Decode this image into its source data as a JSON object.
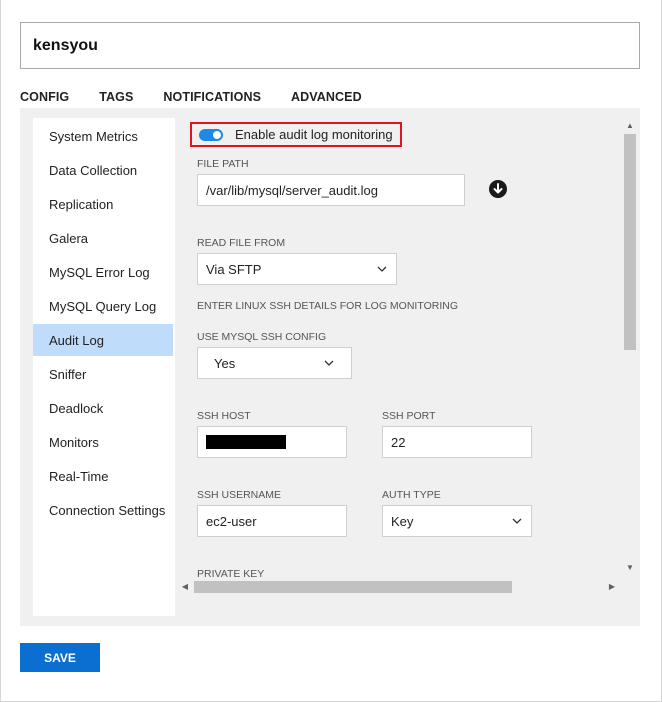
{
  "header": {
    "name": "kensyou"
  },
  "tabs": [
    {
      "label": "CONFIG",
      "active": false
    },
    {
      "label": "TAGS",
      "active": false
    },
    {
      "label": "NOTIFICATIONS",
      "active": false
    },
    {
      "label": "ADVANCED",
      "active": true
    }
  ],
  "sidebar": {
    "items": [
      {
        "label": "System Metrics"
      },
      {
        "label": "Data Collection"
      },
      {
        "label": "Replication"
      },
      {
        "label": "Galera"
      },
      {
        "label": "MySQL Error Log"
      },
      {
        "label": "MySQL Query Log"
      },
      {
        "label": "Audit Log",
        "active": true
      },
      {
        "label": "Sniffer"
      },
      {
        "label": "Deadlock"
      },
      {
        "label": "Monitors"
      },
      {
        "label": "Real-Time"
      },
      {
        "label": "Connection Settings"
      }
    ]
  },
  "audit": {
    "toggle_label": "Enable audit log monitoring",
    "toggle_on": true,
    "file_path_label": "FILE PATH",
    "file_path_value": "/var/lib/mysql/server_audit.log",
    "read_from_label": "READ FILE FROM",
    "read_from_value": "Via SFTP",
    "ssh_note": "ENTER LINUX SSH DETAILS FOR LOG MONITORING",
    "use_ssh_config_label": "USE MYSQL SSH CONFIG",
    "use_ssh_config_value": "Yes",
    "ssh_host_label": "SSH HOST",
    "ssh_port_label": "SSH PORT",
    "ssh_port_value": "22",
    "ssh_username_label": "SSH USERNAME",
    "ssh_username_value": "ec2-user",
    "auth_type_label": "AUTH TYPE",
    "auth_type_value": "Key",
    "private_key_label": "PRIVATE KEY"
  },
  "footer": {
    "save_label": "SAVE"
  },
  "colors": {
    "accent": "#0a6fd1",
    "active_item": "#bfdcfb",
    "highlight_border": "#e0141e"
  },
  "icons": [
    "download-icon",
    "chevron-down-icon",
    "scroll-arrow-icon"
  ]
}
